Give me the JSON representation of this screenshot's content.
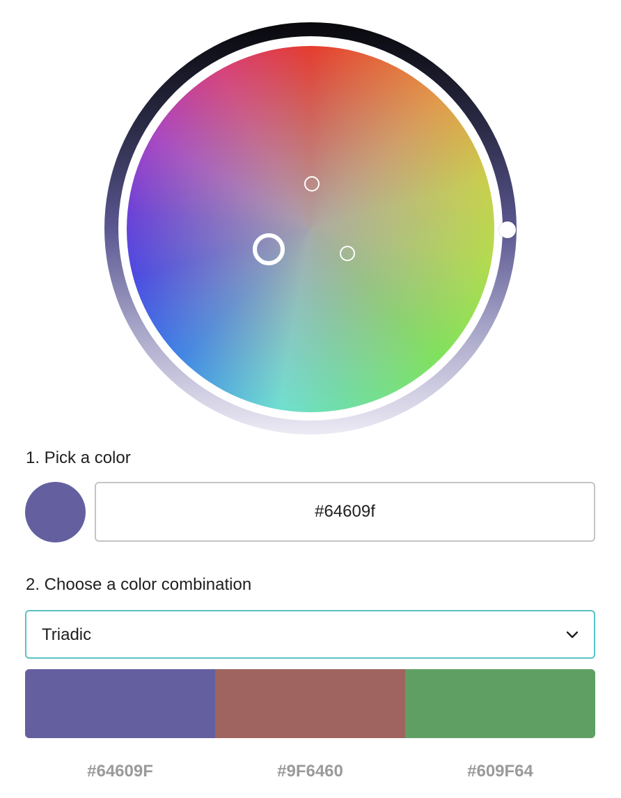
{
  "wheel": {
    "ring_colors": [
      "#08080c",
      "#5a5791",
      "#eceaf4"
    ]
  },
  "step1": {
    "label": "1. Pick a color",
    "selected_color": "#64609f",
    "hex_value": "#64609f"
  },
  "step2": {
    "label": "2. Choose a color combination",
    "selected_option": "Triadic",
    "dropdown_icon": "chevron-down-icon"
  },
  "palette": {
    "swatches": [
      {
        "color": "#64609F",
        "code": "#64609F"
      },
      {
        "color": "#9F6460",
        "code": "#9F6460"
      },
      {
        "color": "#609F64",
        "code": "#609F64"
      }
    ]
  },
  "theme": {
    "accent": "#5bc1c3",
    "input_border": "#c4c4c4",
    "code_text": "#9a9a9a"
  }
}
